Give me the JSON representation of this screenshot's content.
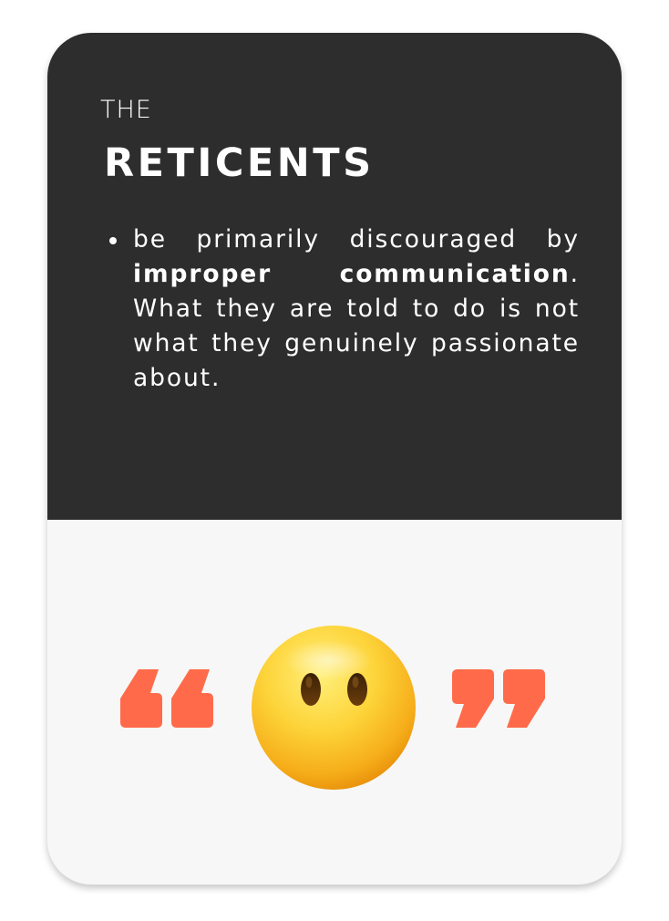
{
  "card": {
    "eyebrow": "THE",
    "title": "RETICENTS",
    "bullet": {
      "before": "be primarily discouraged by ",
      "bold": "improper communication",
      "after": ". What they are told to do is not what they genuinely passionate about."
    }
  },
  "icons": {
    "open_quote": "open-quote-icon",
    "emoji": "face-without-mouth-icon",
    "close_quote": "close-quote-icon"
  },
  "colors": {
    "card_top": "#2d2d2d",
    "card_bottom": "#f7f7f7",
    "accent_quote": "#ff6b4a",
    "text_on_dark": "#ffffff"
  }
}
